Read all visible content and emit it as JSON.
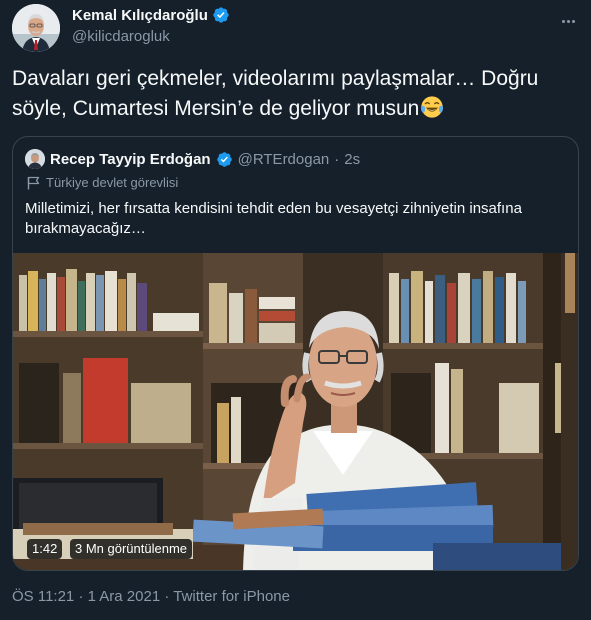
{
  "author": {
    "name": "Kemal Kılıçdaroğlu",
    "handle": "@kilicdarogluk"
  },
  "tweet": {
    "text": "Davaları geri çekmeler, videolarımı paylaşmalar… Doğru söyle, Cumartesi Mersin’e de geliyor musun"
  },
  "quoted": {
    "name": "Recep Tayyip Erdoğan",
    "handle": "@RTErdogan",
    "separator": "·",
    "time": "2s",
    "label": "Türkiye devlet görevlisi",
    "text": "Milletimizi, her fırsatta kendisini tehdit eden bu vesayetçi zihniyetin insafına bırakmayacağız…",
    "video": {
      "duration": "1:42",
      "views": "3 Mn görüntülenme"
    }
  },
  "footer": {
    "time": "ÖS 11:21",
    "separator1": "·",
    "date": "1 Ara 2021",
    "separator2": "·",
    "source": "Twitter for iPhone"
  },
  "colors": {
    "background": "#15202b",
    "text": "#f7f9f9",
    "secondary": "#8b98a5",
    "border": "#38444d",
    "verified": "#1d9bf0"
  }
}
